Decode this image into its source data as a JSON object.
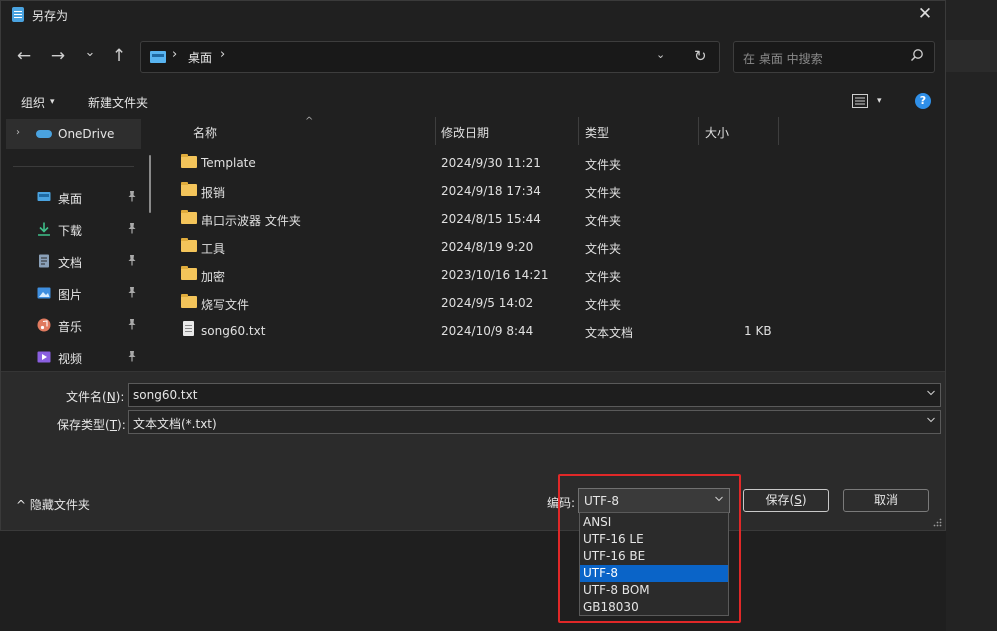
{
  "window": {
    "title": "另存为",
    "close_glyph": "✕"
  },
  "nav": {
    "back_glyph": "←",
    "forward_glyph": "→",
    "recent_glyph": "⌄",
    "up_glyph": "↑",
    "address": {
      "separator": "›",
      "crumb": "桌面",
      "dropdown_glyph": "⌄",
      "refresh_glyph": "↻"
    },
    "search_placeholder": "在 桌面 中搜索"
  },
  "toolbar": {
    "organize_label": "组织",
    "organize_caret": "▾",
    "new_folder_label": "新建文件夹",
    "view_caret": "▾",
    "help_glyph": "?"
  },
  "sidebar": {
    "onedrive": {
      "chevron": "›",
      "label": "OneDrive"
    },
    "items": [
      {
        "label": "桌面",
        "icon": "desktop-icon",
        "color": "#4aa3e0"
      },
      {
        "label": "下载",
        "icon": "download-icon",
        "color": "#3fbf8a"
      },
      {
        "label": "文档",
        "icon": "document-icon",
        "color": "#8aa0b8"
      },
      {
        "label": "图片",
        "icon": "pictures-icon",
        "color": "#3f8fe0"
      },
      {
        "label": "音乐",
        "icon": "music-icon",
        "color": "#e07a5f"
      },
      {
        "label": "视频",
        "icon": "video-icon",
        "color": "#8a5fe0"
      }
    ]
  },
  "columns": {
    "name": "名称",
    "modified": "修改日期",
    "type": "类型",
    "size": "大小",
    "sort_glyph": "^"
  },
  "files": [
    {
      "name": "Template",
      "modified": "2024/9/30 11:21",
      "type": "文件夹",
      "size": "",
      "kind": "folder"
    },
    {
      "name": "报销",
      "modified": "2024/9/18 17:34",
      "type": "文件夹",
      "size": "",
      "kind": "folder"
    },
    {
      "name": "串口示波器 文件夹",
      "modified": "2024/8/15 15:44",
      "type": "文件夹",
      "size": "",
      "kind": "folder"
    },
    {
      "name": "工具",
      "modified": "2024/8/19 9:20",
      "type": "文件夹",
      "size": "",
      "kind": "folder"
    },
    {
      "name": "加密",
      "modified": "2023/10/16 14:21",
      "type": "文件夹",
      "size": "",
      "kind": "folder"
    },
    {
      "name": "烧写文件",
      "modified": "2024/9/5 14:02",
      "type": "文件夹",
      "size": "",
      "kind": "folder"
    },
    {
      "name": "song60.txt",
      "modified": "2024/10/9 8:44",
      "type": "文本文档",
      "size": "1 KB",
      "kind": "txt"
    }
  ],
  "form": {
    "filename_label_prefix": "文件名(",
    "filename_label_key": "N",
    "filename_label_suffix": "):",
    "filename_value": "song60.txt",
    "filetype_label_prefix": "保存类型(",
    "filetype_label_key": "T",
    "filetype_label_suffix": "):",
    "filetype_value": "文本文档(*.txt)",
    "hide_folders_glyph": "^",
    "hide_folders_label": "隐藏文件夹",
    "encoding_label": "编码:",
    "encoding_value": "UTF-8",
    "encoding_options": [
      "ANSI",
      "UTF-16 LE",
      "UTF-16 BE",
      "UTF-8",
      "UTF-8 BOM",
      "GB18030"
    ],
    "encoding_selected": "UTF-8",
    "save_label_prefix": "保存(",
    "save_label_key": "S",
    "save_label_suffix": ")",
    "cancel_label": "取消"
  },
  "colors": {
    "accent": "#0a64c8",
    "highlight_box": "#e02828",
    "folder": "#f3c45a"
  }
}
